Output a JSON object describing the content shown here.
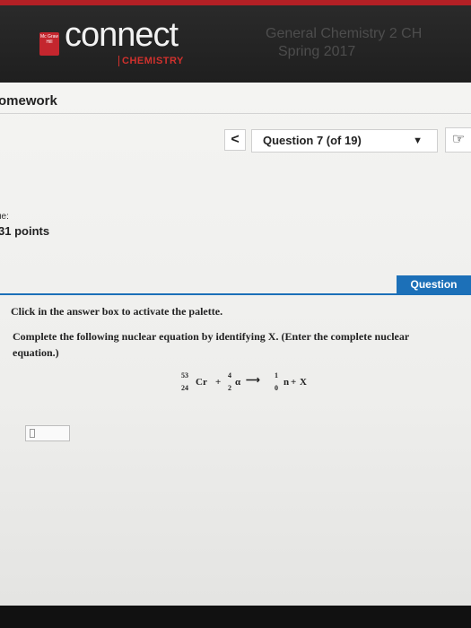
{
  "header": {
    "logo_text": "Mc Graw Hill",
    "app_name": "connect",
    "subject": "CHEMISTRY",
    "course_line1": "General Chemistry 2 CH",
    "course_line2": "Spring 2017"
  },
  "page": {
    "section_title": "omework",
    "nav_prev_label": "<",
    "question_selector": "Question 7 (of 19)",
    "due_label": "ue:",
    "points": "31 points",
    "question_tab": "Question",
    "instruction": "Click in the answer box to activate the palette.",
    "prompt": "Complete the following nuclear equation by identifying X. (Enter the complete nuclear equation.)"
  },
  "equation": {
    "reactant1": {
      "mass": "53",
      "atomic": "24",
      "symbol": "Cr"
    },
    "plus1": "+",
    "reactant2": {
      "mass": "4",
      "atomic": "2",
      "symbol": "α"
    },
    "arrow": "⟶",
    "product1": {
      "mass": "1",
      "atomic": "0",
      "symbol": "n"
    },
    "plus2": "+",
    "unknown": "X"
  },
  "colors": {
    "brand_red": "#c4262e",
    "accent_blue": "#1c70b8"
  },
  "icons": {
    "caret": "triangle-down-icon",
    "hand": "hand-pointer-icon"
  }
}
